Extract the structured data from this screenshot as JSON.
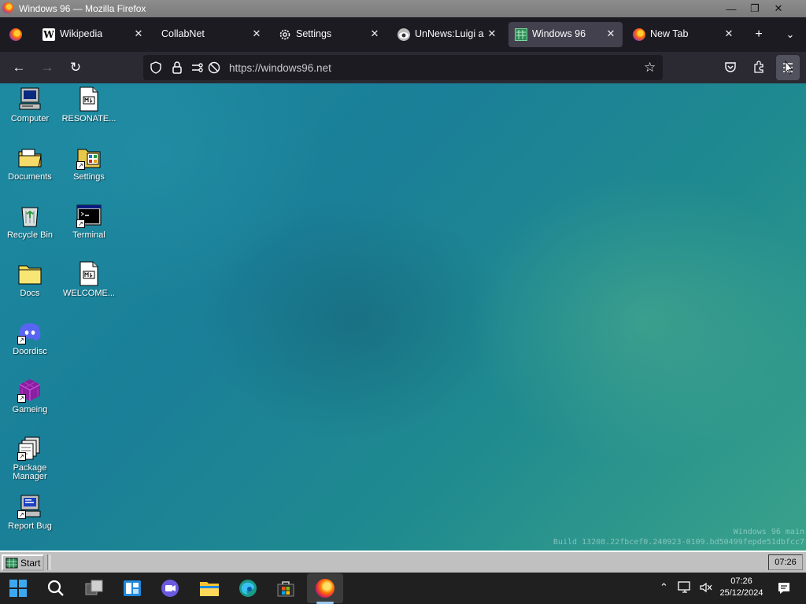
{
  "window": {
    "title": "Windows 96 — Mozilla Firefox"
  },
  "tabs": [
    {
      "label": "Wikipedia",
      "icon": "wikipedia-icon"
    },
    {
      "label": "CollabNet",
      "icon": "blank"
    },
    {
      "label": "Settings",
      "icon": "gear-icon"
    },
    {
      "label": "UnNews:Luigi ap",
      "icon": "unnews-icon"
    },
    {
      "label": "Windows 96",
      "icon": "windows96-icon",
      "active": true
    },
    {
      "label": "New Tab",
      "icon": "firefox-icon"
    }
  ],
  "navbar": {
    "url": "https://windows96.net"
  },
  "desktop": {
    "icons": [
      {
        "label": "Computer",
        "icon": "computer-icon"
      },
      {
        "label": "RESONATE...",
        "icon": "markdown-file-icon"
      },
      {
        "label": "Documents",
        "icon": "folder-open-icon"
      },
      {
        "label": "Settings",
        "icon": "settings-folder-icon"
      },
      {
        "label": "Recycle Bin",
        "icon": "recycle-bin-icon"
      },
      {
        "label": "Terminal",
        "icon": "terminal-icon"
      },
      {
        "label": "Docs",
        "icon": "folder-icon"
      },
      {
        "label": "WELCOME...",
        "icon": "markdown-file-icon"
      },
      {
        "label": "Doordisc",
        "icon": "discord-icon"
      },
      {
        "label": "Gameing",
        "icon": "game-cube-icon"
      },
      {
        "label": "Package Manager",
        "icon": "package-manager-icon"
      },
      {
        "label": "Report Bug",
        "icon": "report-bug-icon"
      }
    ],
    "build_line1": "Windows 96 main",
    "build_line2": "Build 13208.22fbcef0.240923-0109.bd50499fepde51dbfcc7"
  },
  "w96_taskbar": {
    "start_label": "Start",
    "clock": "07:26"
  },
  "win_taskbar": {
    "time": "07:26",
    "date": "25/12/2024"
  },
  "colors": {
    "desktop_accent": "#1d8aa2",
    "tab_active": "#42414d",
    "w96_gray": "#c0c0c0"
  }
}
